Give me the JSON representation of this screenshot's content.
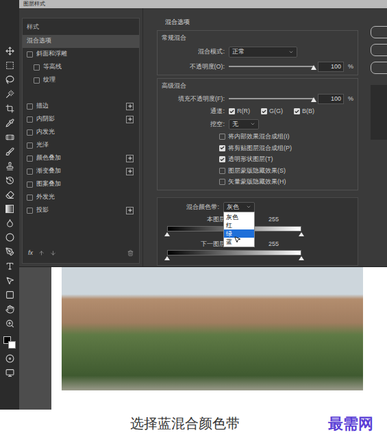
{
  "window": {
    "title": "图层样式"
  },
  "styles_panel": {
    "header": "样式",
    "items": [
      {
        "label": "混合选项",
        "kind": "option",
        "selected": true,
        "checked": false,
        "add_button": false
      },
      {
        "label": "斜面和浮雕",
        "kind": "effect",
        "selected": false,
        "checked": false,
        "add_button": false
      },
      {
        "label": "等高线",
        "kind": "sub",
        "selected": false,
        "checked": false,
        "add_button": false
      },
      {
        "label": "纹理",
        "kind": "sub",
        "selected": false,
        "checked": false,
        "add_button": false
      },
      {
        "label": "描边",
        "kind": "effect",
        "selected": false,
        "checked": false,
        "add_button": true
      },
      {
        "label": "内阴影",
        "kind": "effect",
        "selected": false,
        "checked": false,
        "add_button": true
      },
      {
        "label": "内发光",
        "kind": "effect",
        "selected": false,
        "checked": false,
        "add_button": false
      },
      {
        "label": "光泽",
        "kind": "effect",
        "selected": false,
        "checked": false,
        "add_button": false
      },
      {
        "label": "颜色叠加",
        "kind": "effect",
        "selected": false,
        "checked": false,
        "add_button": true
      },
      {
        "label": "渐变叠加",
        "kind": "effect",
        "selected": false,
        "checked": false,
        "add_button": true
      },
      {
        "label": "图案叠加",
        "kind": "effect",
        "selected": false,
        "checked": false,
        "add_button": false
      },
      {
        "label": "外发光",
        "kind": "effect",
        "selected": false,
        "checked": false,
        "add_button": false
      },
      {
        "label": "投影",
        "kind": "effect",
        "selected": false,
        "checked": false,
        "add_button": true
      }
    ],
    "footer": {
      "fx": "fx"
    }
  },
  "blending": {
    "title": "混合选项",
    "general": {
      "title": "常规混合",
      "blend_mode": {
        "label": "混合模式:",
        "value": "正常"
      },
      "opacity": {
        "label": "不透明度(O):",
        "value": "100",
        "unit": "%",
        "level": 1
      }
    },
    "advanced": {
      "title": "高级混合",
      "fill_opacity": {
        "label": "填充不透明度(F):",
        "value": "100",
        "unit": "%",
        "level": 1
      },
      "channels": {
        "label": "通道:",
        "items": [
          {
            "label": "R(R)",
            "checked": true
          },
          {
            "label": "G(G)",
            "checked": true
          },
          {
            "label": "B(B)",
            "checked": true
          }
        ]
      },
      "knockout": {
        "label": "挖空:",
        "value": "无"
      },
      "options": [
        {
          "label": "将内部效果混合成组(I)",
          "checked": false
        },
        {
          "label": "将剪贴图层混合成组(P)",
          "checked": true
        },
        {
          "label": "透明形状图层(T)",
          "checked": true
        },
        {
          "label": "图层蒙版隐藏效果(S)",
          "checked": false
        },
        {
          "label": "矢量蒙版隐藏效果(H)",
          "checked": false
        }
      ]
    },
    "blend_if": {
      "label": "混合颜色带:",
      "value": "灰色",
      "open": true,
      "options": [
        {
          "label": "灰色",
          "selected": false
        },
        {
          "label": "红",
          "selected": false
        },
        {
          "label": "绿",
          "selected": true
        },
        {
          "label": "蓝",
          "selected": false
        }
      ],
      "this_layer": {
        "label": "本图层:",
        "min": "0",
        "max": "255",
        "levels": [
          0,
          1
        ]
      },
      "underlying": {
        "label": "下一图层:",
        "min": "0",
        "max": "255",
        "levels": [
          0,
          1
        ]
      }
    }
  },
  "caption": {
    "text": "选择蓝混合颜色带",
    "watermark": "最需网"
  }
}
